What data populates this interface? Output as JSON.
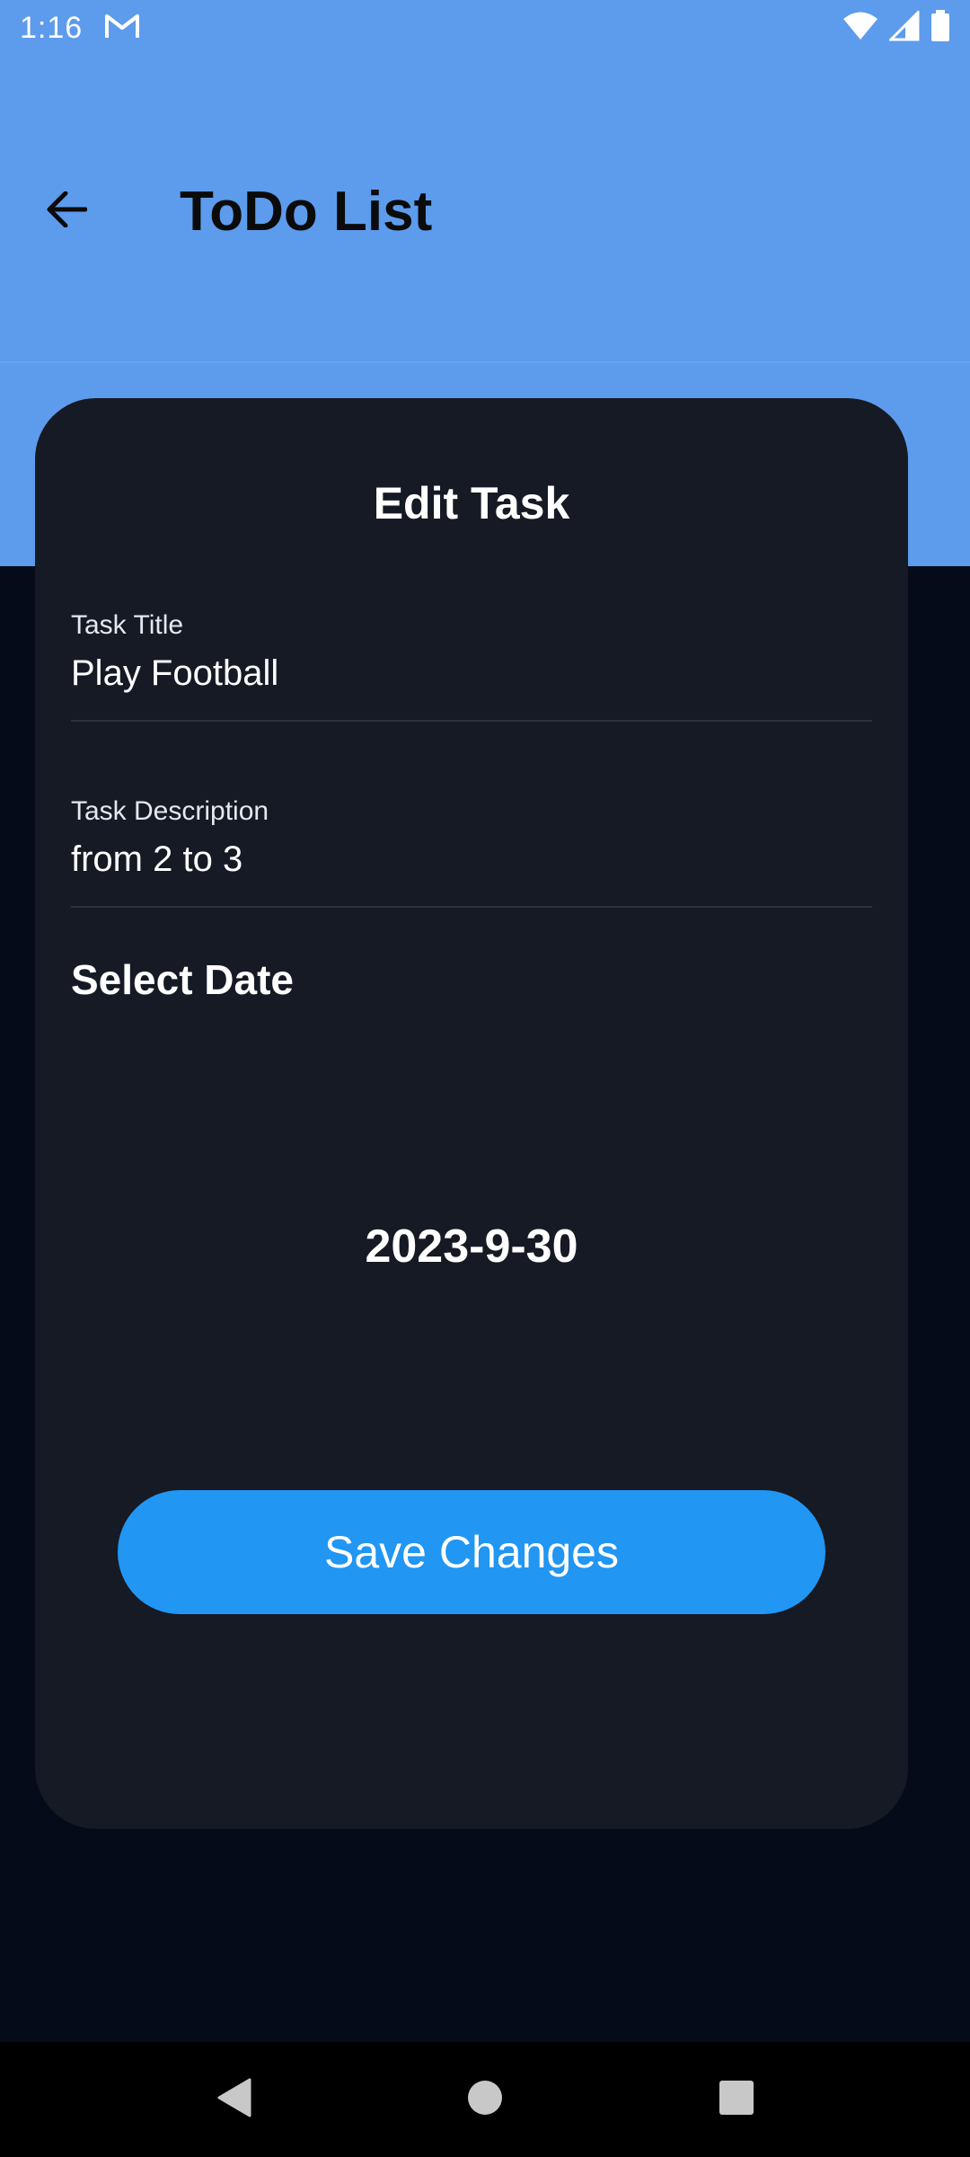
{
  "status_bar": {
    "time": "1:16",
    "icons": [
      "gmail-icon",
      "wifi-icon",
      "signal-icon",
      "battery-icon"
    ]
  },
  "app_bar": {
    "title": "ToDo List",
    "back_icon": "arrow-back-icon"
  },
  "edit_card": {
    "heading": "Edit Task",
    "title_field": {
      "label": "Task Title",
      "value": "Play Football"
    },
    "description_field": {
      "label": "Task Description",
      "value": "from 2 to 3"
    },
    "select_date_label": "Select Date",
    "selected_date": "2023-9-30",
    "save_button_label": "Save Changes"
  },
  "nav_bar": {
    "icons": [
      "back-triangle-icon",
      "home-circle-icon",
      "recents-square-icon"
    ]
  },
  "colors": {
    "header_blue": "#5d9bec",
    "card_background": "#161a24",
    "page_background": "#060b1a",
    "button_blue": "#2196f3"
  }
}
